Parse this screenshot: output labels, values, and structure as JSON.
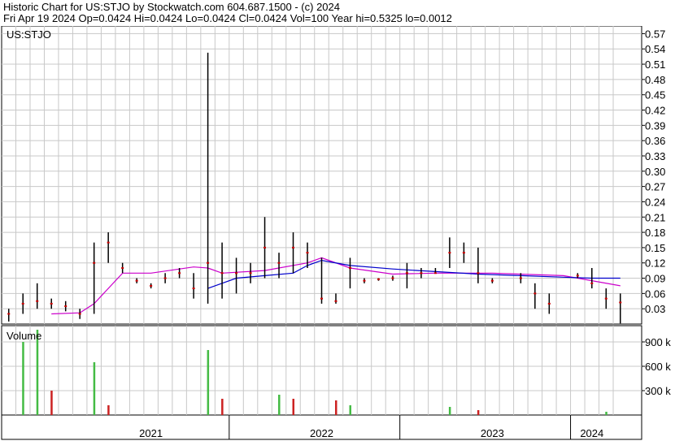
{
  "header": {
    "line1": "Historic Chart for US:STJO by Stockwatch.com 604.687.1500 - (c) 2024",
    "line2": "Fri Apr 19 2024   Op=0.0424   Hi=0.0424   Lo=0.0424   Cl=0.0424   Vol=100   Year hi=0.5325   lo=0.0012"
  },
  "colors": {
    "grid": "#c8c8c8",
    "price": "#000000",
    "close_dot": "#cc0000",
    "ma_short": "#0000cc",
    "ma_long": "#cc00cc",
    "vol_up": "#44bb44",
    "vol_down": "#cc2222"
  },
  "chart_data": [
    {
      "type": "line",
      "title": "US:STJO",
      "ylim": [
        0,
        0.585
      ],
      "yticks": [
        "0.03",
        "0.06",
        "0.09",
        "0.12",
        "0.15",
        "0.18",
        "0.21",
        "0.24",
        "0.27",
        "0.30",
        "0.33",
        "0.36",
        "0.39",
        "0.42",
        "0.45",
        "0.48",
        "0.51",
        "0.54",
        "0.57"
      ],
      "x_range": [
        "2020-09",
        "2024-05"
      ],
      "x_labels": [
        {
          "label": "2021",
          "at": "2021-07"
        },
        {
          "label": "2022",
          "at": "2022-07"
        },
        {
          "label": "2023",
          "at": "2023-07"
        },
        {
          "label": "2024",
          "at": "2024-02"
        }
      ],
      "year_dividers": [
        "2021-12",
        "2022-12",
        "2023-12"
      ],
      "grid_months": [
        "2020-10",
        "2020-11",
        "2020-12",
        "2021-01",
        "2021-02",
        "2021-03",
        "2021-04",
        "2021-05",
        "2021-06",
        "2021-07",
        "2021-08",
        "2021-09",
        "2021-10",
        "2021-11",
        "2021-12",
        "2022-01",
        "2022-02",
        "2022-03",
        "2022-04",
        "2022-05",
        "2022-06",
        "2022-07",
        "2022-08",
        "2022-09",
        "2022-10",
        "2022-11",
        "2022-12",
        "2023-01",
        "2023-02",
        "2023-03",
        "2023-04",
        "2023-05",
        "2023-06",
        "2023-07",
        "2023-08",
        "2023-09",
        "2023-10",
        "2023-11",
        "2023-12",
        "2024-01",
        "2024-02",
        "2024-03",
        "2024-04"
      ],
      "price_bars": [
        {
          "t": "2020-09",
          "lo": 0.005,
          "hi": 0.03,
          "c": 0.02
        },
        {
          "t": "2020-10",
          "lo": 0.02,
          "hi": 0.06,
          "c": 0.04
        },
        {
          "t": "2020-11",
          "lo": 0.03,
          "hi": 0.08,
          "c": 0.045
        },
        {
          "t": "2020-12",
          "lo": 0.03,
          "hi": 0.05,
          "c": 0.04
        },
        {
          "t": "2021-01",
          "lo": 0.025,
          "hi": 0.045,
          "c": 0.035
        },
        {
          "t": "2021-02",
          "lo": 0.01,
          "hi": 0.03,
          "c": 0.02
        },
        {
          "t": "2021-03",
          "lo": 0.02,
          "hi": 0.16,
          "c": 0.12
        },
        {
          "t": "2021-04",
          "lo": 0.12,
          "hi": 0.18,
          "c": 0.16
        },
        {
          "t": "2021-05",
          "lo": 0.1,
          "hi": 0.12,
          "c": 0.11
        },
        {
          "t": "2021-06",
          "lo": 0.08,
          "hi": 0.09,
          "c": 0.085
        },
        {
          "t": "2021-07",
          "lo": 0.07,
          "hi": 0.08,
          "c": 0.075
        },
        {
          "t": "2021-08",
          "lo": 0.08,
          "hi": 0.1,
          "c": 0.09
        },
        {
          "t": "2021-09",
          "lo": 0.09,
          "hi": 0.11,
          "c": 0.1
        },
        {
          "t": "2021-10",
          "lo": 0.05,
          "hi": 0.1,
          "c": 0.07
        },
        {
          "t": "2021-11",
          "lo": 0.04,
          "hi": 0.5325,
          "c": 0.12
        },
        {
          "t": "2021-12",
          "lo": 0.05,
          "hi": 0.16,
          "c": 0.1
        },
        {
          "t": "2022-01",
          "lo": 0.06,
          "hi": 0.13,
          "c": 0.1
        },
        {
          "t": "2022-02",
          "lo": 0.08,
          "hi": 0.12,
          "c": 0.1
        },
        {
          "t": "2022-03",
          "lo": 0.09,
          "hi": 0.21,
          "c": 0.15
        },
        {
          "t": "2022-04",
          "lo": 0.09,
          "hi": 0.14,
          "c": 0.12
        },
        {
          "t": "2022-05",
          "lo": 0.1,
          "hi": 0.18,
          "c": 0.15
        },
        {
          "t": "2022-06",
          "lo": 0.11,
          "hi": 0.16,
          "c": 0.14
        },
        {
          "t": "2022-07",
          "lo": 0.04,
          "hi": 0.13,
          "c": 0.05
        },
        {
          "t": "2022-08",
          "lo": 0.04,
          "hi": 0.06,
          "c": 0.045
        },
        {
          "t": "2022-09",
          "lo": 0.07,
          "hi": 0.13,
          "c": 0.11
        },
        {
          "t": "2022-10",
          "lo": 0.08,
          "hi": 0.09,
          "c": 0.085
        },
        {
          "t": "2022-11",
          "lo": 0.085,
          "hi": 0.09,
          "c": 0.088
        },
        {
          "t": "2022-12",
          "lo": 0.085,
          "hi": 0.095,
          "c": 0.09
        },
        {
          "t": "2023-01",
          "lo": 0.07,
          "hi": 0.12,
          "c": 0.1
        },
        {
          "t": "2023-02",
          "lo": 0.09,
          "hi": 0.11,
          "c": 0.1
        },
        {
          "t": "2023-03",
          "lo": 0.1,
          "hi": 0.11,
          "c": 0.1
        },
        {
          "t": "2023-04",
          "lo": 0.11,
          "hi": 0.17,
          "c": 0.14
        },
        {
          "t": "2023-05",
          "lo": 0.12,
          "hi": 0.16,
          "c": 0.14
        },
        {
          "t": "2023-06",
          "lo": 0.08,
          "hi": 0.15,
          "c": 0.1
        },
        {
          "t": "2023-07",
          "lo": 0.08,
          "hi": 0.09,
          "c": 0.085
        },
        {
          "t": "2023-09",
          "lo": 0.08,
          "hi": 0.1,
          "c": 0.09
        },
        {
          "t": "2023-10",
          "lo": 0.03,
          "hi": 0.08,
          "c": 0.06
        },
        {
          "t": "2023-11",
          "lo": 0.02,
          "hi": 0.06,
          "c": 0.04
        },
        {
          "t": "2024-01",
          "lo": 0.09,
          "hi": 0.1,
          "c": 0.095
        },
        {
          "t": "2024-02",
          "lo": 0.07,
          "hi": 0.11,
          "c": 0.08
        },
        {
          "t": "2024-03",
          "lo": 0.03,
          "hi": 0.07,
          "c": 0.05
        },
        {
          "t": "2024-04",
          "lo": 0.0012,
          "hi": 0.06,
          "c": 0.0424
        }
      ],
      "series": [
        {
          "x": [
            "2020-12",
            "2021-02",
            "2021-03",
            "2021-05",
            "2021-07",
            "2021-10",
            "2021-11",
            "2021-12",
            "2022-03",
            "2022-06",
            "2022-07",
            "2022-09",
            "2022-12",
            "2023-03",
            "2023-07",
            "2023-12",
            "2024-04"
          ],
          "values": [
            0.02,
            0.022,
            0.04,
            0.1,
            0.1,
            0.112,
            0.11,
            0.1,
            0.105,
            0.12,
            0.13,
            0.11,
            0.098,
            0.1,
            0.1,
            0.095,
            0.075
          ]
        },
        {
          "x": [
            "2021-11",
            "2021-12",
            "2022-01",
            "2022-03",
            "2022-05",
            "2022-06",
            "2022-07",
            "2022-09",
            "2022-12",
            "2023-03",
            "2023-06",
            "2023-09",
            "2023-12",
            "2024-02",
            "2024-04"
          ],
          "values": [
            0.07,
            0.08,
            0.09,
            0.095,
            0.1,
            0.115,
            0.125,
            0.115,
            0.108,
            0.103,
            0.098,
            0.095,
            0.092,
            0.09,
            0.09
          ]
        }
      ]
    },
    {
      "type": "bar",
      "title": "Volume",
      "ylim": [
        0,
        1100000
      ],
      "yticks": [
        "300 k",
        "600 k",
        "900 k"
      ],
      "bars": [
        {
          "t": "2020-10",
          "v": 900000,
          "up": true
        },
        {
          "t": "2020-11",
          "v": 1050000,
          "up": true
        },
        {
          "t": "2020-12",
          "v": 300000,
          "up": false
        },
        {
          "t": "2021-03",
          "v": 650000,
          "up": true
        },
        {
          "t": "2021-04",
          "v": 120000,
          "up": false
        },
        {
          "t": "2021-11",
          "v": 800000,
          "up": true
        },
        {
          "t": "2021-12",
          "v": 200000,
          "up": false
        },
        {
          "t": "2022-04",
          "v": 250000,
          "up": true
        },
        {
          "t": "2022-05",
          "v": 200000,
          "up": false
        },
        {
          "t": "2022-08",
          "v": 180000,
          "up": false
        },
        {
          "t": "2022-09",
          "v": 120000,
          "up": true
        },
        {
          "t": "2023-04",
          "v": 100000,
          "up": true
        },
        {
          "t": "2023-06",
          "v": 60000,
          "up": false
        },
        {
          "t": "2024-03",
          "v": 40000,
          "up": true
        }
      ]
    }
  ]
}
